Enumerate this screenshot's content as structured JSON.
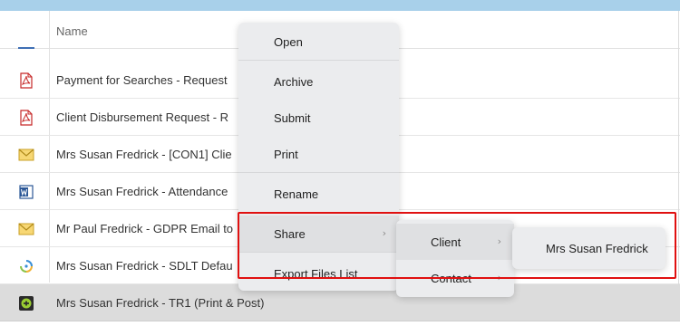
{
  "table": {
    "header_name": "Name",
    "rows": [
      {
        "name": "Payment for Searches  - Request",
        "icon": "pdf-icon"
      },
      {
        "name": "Client Disbursement Request  - R",
        "icon": "pdf-icon"
      },
      {
        "name": "Mrs Susan Fredrick - [CON1] Clie",
        "icon": "email-icon"
      },
      {
        "name": "Mrs Susan Fredrick - Attendance",
        "icon": "word-doc-icon"
      },
      {
        "name": "Mr Paul Fredrick - GDPR Email to",
        "icon": "email-icon"
      },
      {
        "name": "Mrs Susan Fredrick - SDLT Defau",
        "icon": "sdlt-icon"
      },
      {
        "name": "Mrs Susan Fredrick - TR1 (Print & Post)",
        "icon": "form-icon",
        "selected": true
      }
    ]
  },
  "context_menu": {
    "items": [
      "Open",
      "Archive",
      "Submit",
      "Print",
      "Rename",
      "Share",
      "Export Files List"
    ]
  },
  "share_submenu": {
    "items": [
      "Client",
      "Contact"
    ]
  },
  "client_submenu": {
    "items": [
      "Mrs Susan Fredrick"
    ]
  },
  "colors": {
    "accent_strip": "#a8d0ea",
    "highlight": "#e01010",
    "selected_row": "#dcdcdc"
  }
}
